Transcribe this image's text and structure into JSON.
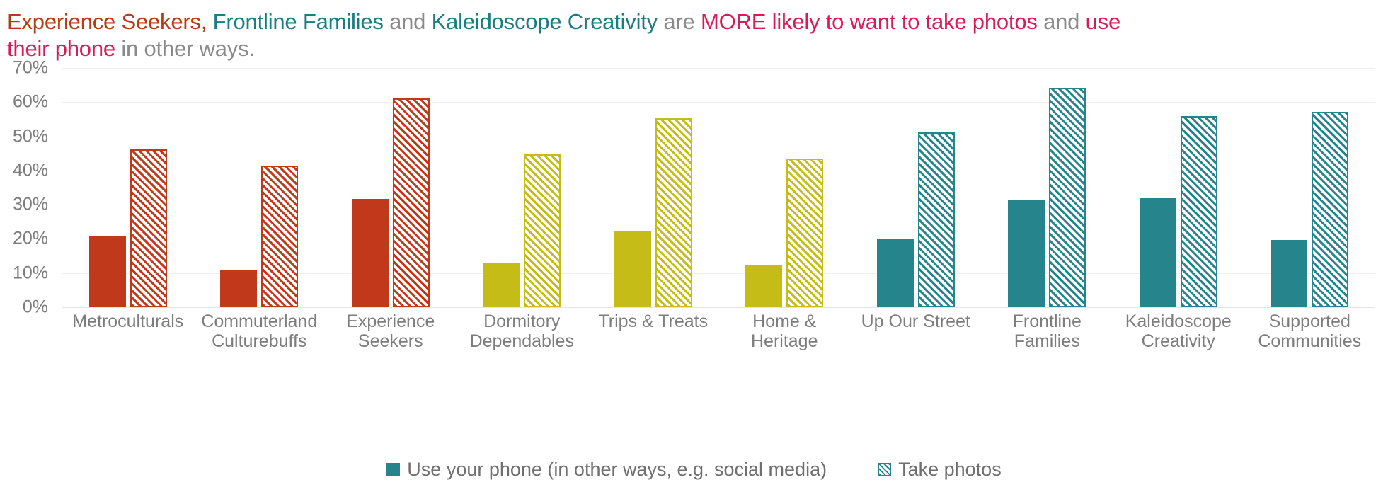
{
  "title": {
    "segments": [
      {
        "text": "Experience Seekers",
        "color_role": "rust"
      },
      {
        "text": ", ",
        "color_role": "rust"
      },
      {
        "text": "Frontline Families",
        "color_role": "teal"
      },
      {
        "text": " and ",
        "color_role": "grey"
      },
      {
        "text": "Kaleidoscope Creativity",
        "color_role": "teal"
      },
      {
        "text": " are ",
        "color_role": "grey"
      },
      {
        "text": "MORE likely to want to take photos",
        "color_role": "crimson"
      },
      {
        "text": " and ",
        "color_role": "grey"
      },
      {
        "text": "use their phone",
        "color_role": "crimson"
      },
      {
        "text": " in other ways.",
        "color_role": "grey"
      }
    ],
    "plain": "Experience Seekers, Frontline Families and Kaleidoscope Creativity are MORE likely to want to take photos and use their phone in other ways."
  },
  "colors": {
    "rust": "#b53a18",
    "teal": "#1d7b83",
    "grey": "#8a8a8a",
    "crimson": "#d81b56",
    "bar_rust": "#c0391a",
    "bar_olive": "#c5bc18",
    "bar_teal": "#26848c",
    "gridline": "#efefef",
    "axis_text": "#7d7d7d"
  },
  "chart_data": {
    "type": "bar",
    "title": "Experience Seekers, Frontline Families and Kaleidoscope Creativity are MORE likely to want to take photos and use their phone in other ways.",
    "xlabel": "",
    "ylabel": "",
    "ylim": [
      0,
      70
    ],
    "ytick_labels": [
      "0%",
      "10%",
      "20%",
      "30%",
      "40%",
      "50%",
      "60%",
      "70%"
    ],
    "ytick_values": [
      0,
      10,
      20,
      30,
      40,
      50,
      60,
      70
    ],
    "grid": true,
    "legend_position": "bottom",
    "categories": [
      "Metroculturals",
      "Commuterland Culturebuffs",
      "Experience Seekers",
      "Dormitory Dependables",
      "Trips & Treats",
      "Home & Heritage",
      "Up Our Street",
      "Frontline Families",
      "Kaleidoscope Creativity",
      "Supported Communities"
    ],
    "category_colors": [
      "#c0391a",
      "#c0391a",
      "#c0391a",
      "#c5bc18",
      "#c5bc18",
      "#c5bc18",
      "#26848c",
      "#26848c",
      "#26848c",
      "#26848c"
    ],
    "series": [
      {
        "name": "Use your phone (in other ways, e.g. social media)",
        "fill": "solid",
        "values": [
          21.0,
          10.7,
          31.7,
          12.8,
          22.1,
          12.4,
          19.9,
          31.3,
          31.9,
          19.7
        ]
      },
      {
        "name": "Take photos",
        "fill": "hatched",
        "values": [
          46.2,
          41.4,
          61.0,
          44.8,
          55.3,
          43.4,
          51.1,
          64.3,
          56.0,
          57.1
        ]
      }
    ]
  },
  "legend": {
    "items": [
      {
        "label": "Use your phone (in other ways, e.g. social media)",
        "swatch": "solid"
      },
      {
        "label": "Take photos",
        "swatch": "hatch"
      }
    ]
  }
}
